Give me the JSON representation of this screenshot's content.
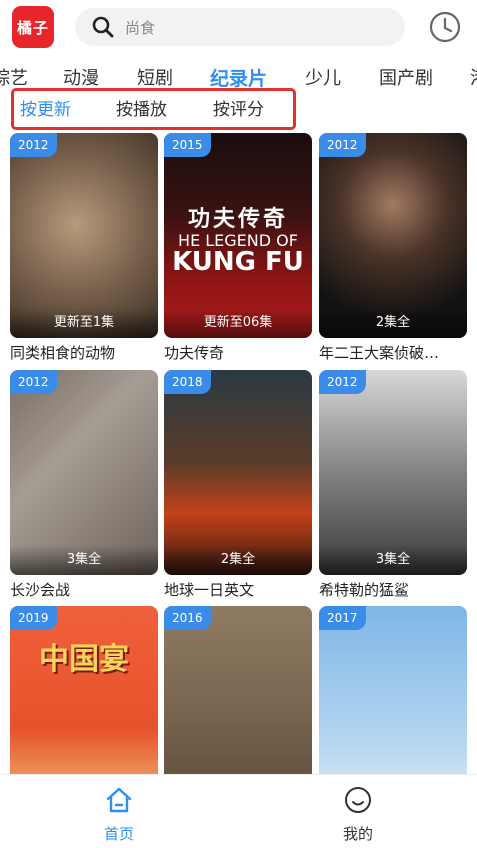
{
  "header": {
    "logo_text": "橘子",
    "search_placeholder": "尚食",
    "icons": {
      "search": "search-icon",
      "history": "clock-icon"
    }
  },
  "categories": [
    {
      "label": "综艺",
      "active": false
    },
    {
      "label": "动漫",
      "active": false
    },
    {
      "label": "短剧",
      "active": false
    },
    {
      "label": "纪录片",
      "active": true
    },
    {
      "label": "少儿",
      "active": false
    },
    {
      "label": "国产剧",
      "active": false
    },
    {
      "label": "港",
      "active": false
    }
  ],
  "sort_tabs": [
    {
      "label": "按更新",
      "active": true
    },
    {
      "label": "按播放",
      "active": false
    },
    {
      "label": "按评分",
      "active": false
    }
  ],
  "cards": [
    {
      "year": "2012",
      "status": "更新至1集",
      "title": "同类相食的动物"
    },
    {
      "year": "2015",
      "status": "更新至06集",
      "title": "功夫传奇",
      "poster_text_cn": "功夫传奇",
      "poster_text_en1": "HE LEGEND OF",
      "poster_text_en2": "KUNG FU"
    },
    {
      "year": "2012",
      "status": "2集全",
      "title": "年二王大案侦破…"
    },
    {
      "year": "2012",
      "status": "3集全",
      "title": "长沙会战"
    },
    {
      "year": "2018",
      "status": "2集全",
      "title": "地球一日英文"
    },
    {
      "year": "2012",
      "status": "3集全",
      "title": "希特勒的猛鲨"
    },
    {
      "year": "2019",
      "status": "",
      "title": "",
      "poster_text_cn": "中国宴"
    },
    {
      "year": "2016",
      "status": "",
      "title": ""
    },
    {
      "year": "2017",
      "status": "",
      "title": ""
    }
  ],
  "bottom_nav": [
    {
      "label": "首页",
      "icon": "home-icon",
      "active": true
    },
    {
      "label": "我的",
      "icon": "smiley-icon",
      "active": false
    }
  ],
  "colors": {
    "accent": "#2e8ff0",
    "logo": "#e8252b",
    "highlight_border": "#e0312f",
    "year_badge": "#3a8ce8"
  }
}
